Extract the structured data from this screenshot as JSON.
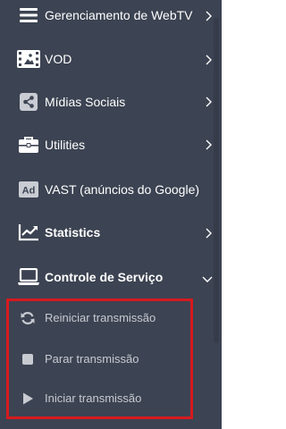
{
  "menu": {
    "items": [
      {
        "label": "Gerenciamento de WebTV",
        "icon": "hamburger-icon",
        "has_chevron": true
      },
      {
        "label": "VOD",
        "icon": "film-icon",
        "has_chevron": true
      },
      {
        "label": "Mídias Sociais",
        "icon": "share-icon",
        "has_chevron": true
      },
      {
        "label": "Utilities",
        "icon": "briefcase-icon",
        "has_chevron": true
      },
      {
        "label": "VAST (anúncios do Google)",
        "icon": "ad-icon",
        "has_chevron": false
      },
      {
        "label": "Statistics",
        "icon": "line-chart-icon",
        "has_chevron": true
      },
      {
        "label": "Controle de Serviço",
        "icon": "laptop-icon",
        "has_chevron": true,
        "expanded": true
      }
    ],
    "ad_badge": "Ad",
    "service_control": {
      "subitems": [
        {
          "label": "Reiniciar transmissão",
          "icon": "refresh-icon"
        },
        {
          "label": "Parar transmissão",
          "icon": "stop-icon"
        },
        {
          "label": "Iniciar transmissão",
          "icon": "play-icon"
        }
      ]
    }
  },
  "colors": {
    "sidebar_bg": "#3c4352",
    "text": "#ffffff",
    "subtext": "#c7cad1",
    "highlight": "#d51a1f"
  }
}
